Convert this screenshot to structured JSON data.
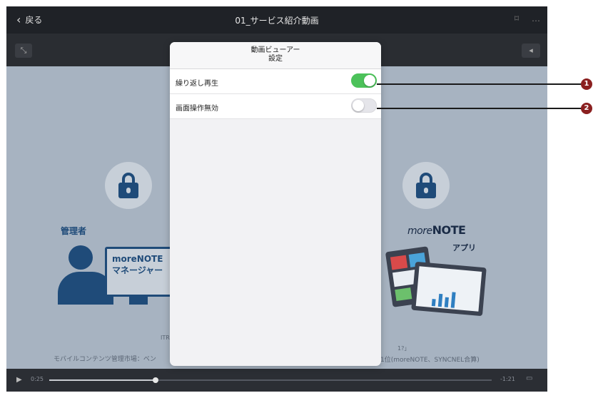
{
  "topbar": {
    "back_label": "戻る",
    "title": "01_サービス紹介動画",
    "bookmark_icon": "bookmark-icon",
    "more_icon": "more-icon"
  },
  "video_slide": {
    "admin_label": "管理者",
    "monitor_line1": "moreNOTE",
    "monitor_line2": "マネージャー",
    "brand_main": "more",
    "brand_bold": "NOTE",
    "app_label": "アプリ",
    "caption_left_top": "ITR",
    "caption_left_bottom": "モバイルコンテンツ管理市場：ベン",
    "caption_right_top": "1?」",
    "caption_right_bottom": "1位(moreNOTE、SYNCNEL合算)"
  },
  "player": {
    "time_elapsed": "0:25",
    "time_remaining": "-1:21",
    "progress_fraction": 0.24
  },
  "popover": {
    "title": "動画ビューアー\n設定",
    "rows": [
      {
        "label": "繰り返し再生",
        "on": true
      },
      {
        "label": "画面操作無効",
        "on": false
      }
    ]
  },
  "callouts": [
    "1",
    "2"
  ],
  "colors": {
    "toggle_on": "#4cc25a",
    "callout": "#8b2020",
    "slide_bg": "#a7b3c1",
    "brand_blue": "#1f4b79"
  }
}
